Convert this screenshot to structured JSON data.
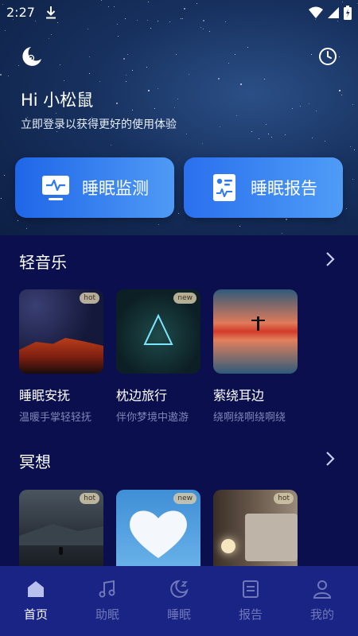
{
  "status": {
    "time": "2:27"
  },
  "header": {
    "greeting": "Hi 小松鼠",
    "subtitle": "立即登录以获得更好的使用体验"
  },
  "actions": {
    "monitor_label": "睡眠监测",
    "report_label": "睡眠报告"
  },
  "music": {
    "title": "轻音乐",
    "items": [
      {
        "title": "睡眠安抚",
        "subtitle": "温暖手掌轻轻抚",
        "tag": "hot"
      },
      {
        "title": "枕边旅行",
        "subtitle": "伴你梦境中遨游",
        "tag": "new"
      },
      {
        "title": "萦绕耳边",
        "subtitle": "绕啊绕啊绕啊绕",
        "tag": ""
      }
    ]
  },
  "meditation": {
    "title": "冥想",
    "items": [
      {
        "tag": "hot"
      },
      {
        "tag": "new"
      },
      {
        "tag": "hot"
      }
    ]
  },
  "nav": {
    "items": [
      {
        "label": "首页",
        "icon": "home-icon"
      },
      {
        "label": "助眠",
        "icon": "music-note-icon"
      },
      {
        "label": "睡眠",
        "icon": "moon-icon"
      },
      {
        "label": "报告",
        "icon": "report-icon"
      },
      {
        "label": "我的",
        "icon": "user-icon"
      }
    ]
  },
  "colors": {
    "background": "#0b0f4d",
    "nav_background": "#1a2484",
    "accent": "#3f87f2",
    "subtext": "#7d86b8"
  }
}
